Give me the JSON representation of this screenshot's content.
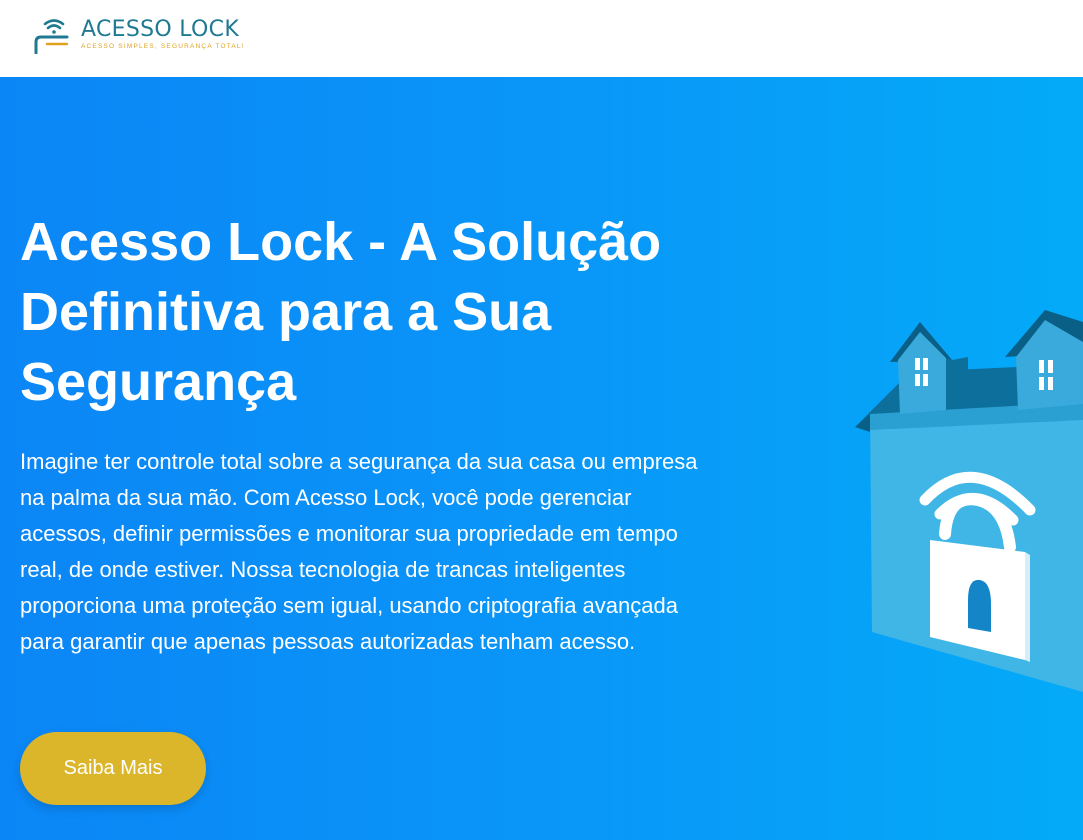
{
  "header": {
    "logo_title": "ACESSO LOCK",
    "logo_tagline": "ACESSO SIMPLES, SEGURANÇA TOTAL!",
    "logo_icon": "wifi-lock-logo-icon"
  },
  "hero": {
    "title": "Acesso Lock - A Solução Definitiva para a Sua Segurança",
    "description": "Imagine ter controle total sobre a segurança da sua casa ou empresa na palma da sua mão. Com Acesso Lock, você pode gerenciar acessos, definir permissões e monitorar sua propriedade em tempo real, de onde estiver. Nossa tecnologia de trancas inteligentes proporciona uma proteção sem igual, usando criptografia avançada para garantir que apenas pessoas autorizadas tenham acesso.",
    "cta_label": "Saiba Mais",
    "illustration": "smart-house-lock-illustration"
  },
  "colors": {
    "brand_teal": "#1f7a91",
    "brand_gold": "#e0a321",
    "hero_gradient_start": "#0b86f6",
    "hero_gradient_end": "#04aaf8",
    "cta_background": "#dbb52a"
  }
}
